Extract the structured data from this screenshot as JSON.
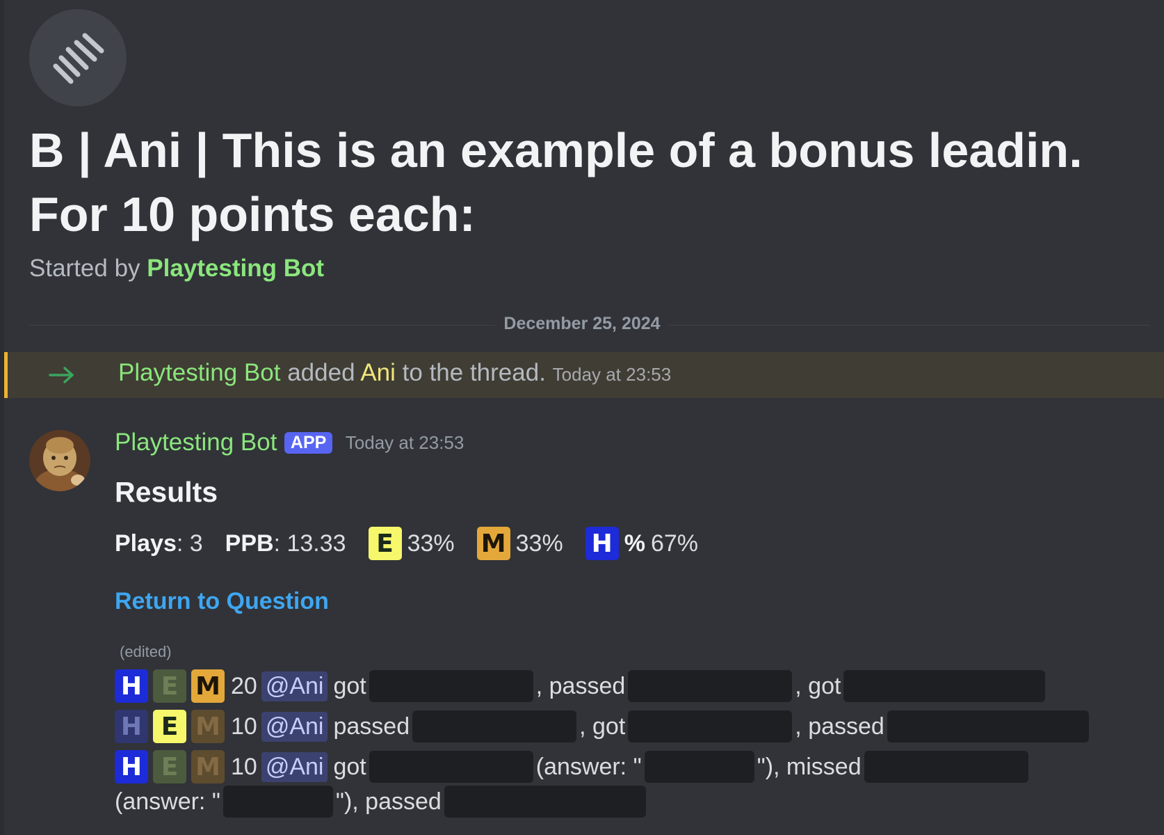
{
  "thread": {
    "title": "B | Ani | This is an example of a bonus leadin. For 10 points each:",
    "started_by_label": "Started by",
    "started_by_user": "Playtesting Bot"
  },
  "date_divider": "December 25, 2024",
  "system_message": {
    "actor": "Playtesting Bot",
    "verb": "added",
    "target": "Ani",
    "rest": "to the thread.",
    "timestamp": "Today at 23:53"
  },
  "message": {
    "author": "Playtesting Bot",
    "badge": "APP",
    "timestamp": "Today at 23:53",
    "heading": "Results",
    "stats": {
      "plays_label": "Plays",
      "plays_value": ": 3",
      "ppb_label": "PPB",
      "ppb_value": ": 13.33",
      "e_pct": "33%",
      "m_pct": "33%",
      "h_prefix": "%",
      "h_pct": "67%"
    },
    "return_link": "Return to Question",
    "edited": "(edited)",
    "difficulty_letters": {
      "h": "H",
      "e": "E",
      "m": "M"
    },
    "log": [
      {
        "points": "20",
        "mention": "@Ani",
        "words": [
          "got",
          ", passed",
          ", got"
        ]
      },
      {
        "points": "10",
        "mention": "@Ani",
        "words": [
          "passed",
          ", got",
          ", passed"
        ]
      },
      {
        "points": "10",
        "mention": "@Ani",
        "words": [
          "got",
          "(answer: \"",
          "\"), missed",
          "(answer: \"",
          "\"), passed"
        ]
      }
    ]
  },
  "colors": {
    "background": "#313338",
    "bot_green": "#8be67d",
    "link_blue": "#3fa6f0",
    "app_badge": "#5865f2",
    "system_highlight": "#3f3d34",
    "system_border": "#f0b232"
  },
  "icons": [
    "thread-icon",
    "arrow-right-icon",
    "avatar"
  ]
}
